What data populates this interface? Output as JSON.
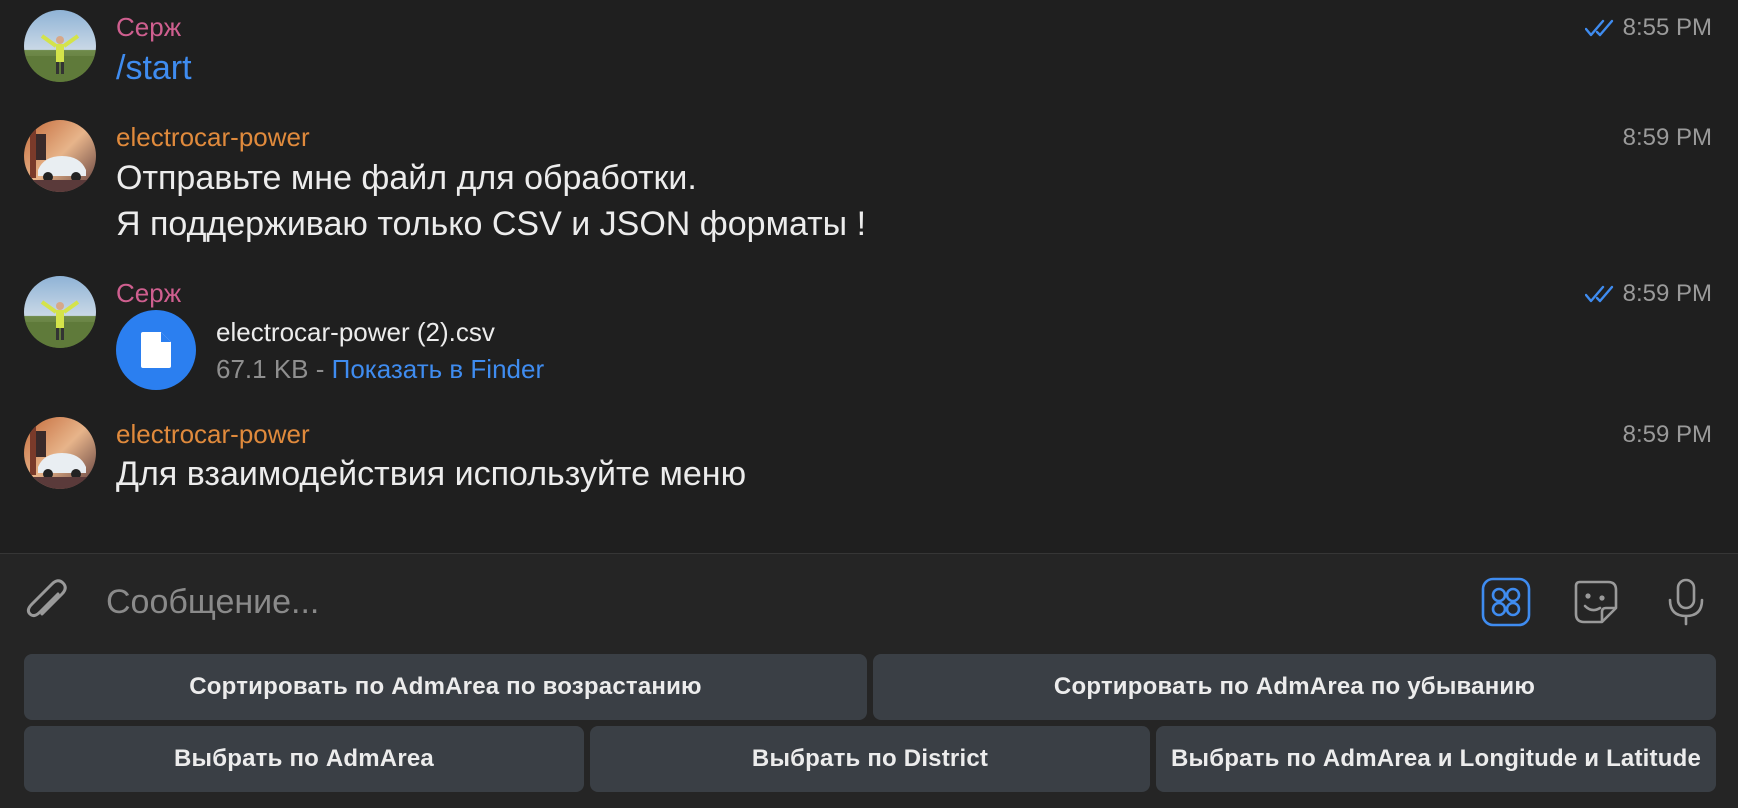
{
  "messages": [
    {
      "sender": "Серж",
      "time": "8:55 PM",
      "read": true,
      "text": "/start"
    },
    {
      "sender": "electrocar-power",
      "time": "8:59 PM",
      "read": false,
      "lines": [
        "Отправьте мне файл для обработки.",
        "Я поддерживаю только CSV и JSON форматы !"
      ]
    },
    {
      "sender": "Серж",
      "time": "8:59 PM",
      "read": true,
      "file": {
        "name": "electrocar-power (2).csv",
        "size": "67.1 KB",
        "separator": " - ",
        "action": "Показать в Finder"
      }
    },
    {
      "sender": "electrocar-power",
      "time": "8:59 PM",
      "read": false,
      "text": "Для взаимодействия используйте меню"
    }
  ],
  "composer": {
    "placeholder": "Сообщение...",
    "icons": [
      "paperclip-icon",
      "bot-menu-icon",
      "sticker-icon",
      "microphone-icon"
    ]
  },
  "keyboard": {
    "rows": [
      [
        "Сортировать по AdmArea по возрастанию",
        "Сортировать по AdmArea по убыванию"
      ],
      [
        "Выбрать по AdmArea",
        "Выбрать по District",
        "Выбрать по AdmArea и Longitude и Latitude"
      ]
    ]
  },
  "colors": {
    "background": "#1f1f1f",
    "user_name": "#cf5f8f",
    "bot_name": "#e08a3c",
    "accent": "#3f8cf0",
    "keyboard_button": "#3a3f45"
  }
}
